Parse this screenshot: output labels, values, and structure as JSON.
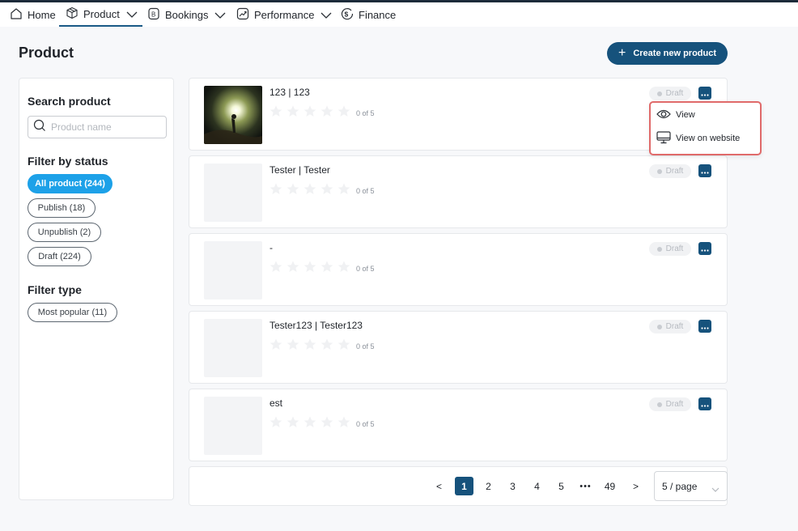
{
  "nav": {
    "items": [
      {
        "label": "Home",
        "icon": "home-icon"
      },
      {
        "label": "Product",
        "icon": "box-icon",
        "has_dropdown": true,
        "active": true
      },
      {
        "label": "Bookings",
        "icon": "bookings-icon",
        "has_dropdown": true
      },
      {
        "label": "Performance",
        "icon": "trend-icon",
        "has_dropdown": true
      },
      {
        "label": "Finance",
        "icon": "dollar-icon"
      }
    ]
  },
  "page": {
    "title": "Product",
    "create_button": "Create new product"
  },
  "sidebar": {
    "search_heading": "Search product",
    "search_placeholder": "Product name",
    "status_heading": "Filter by status",
    "status_filters": [
      "All product (244)",
      "Publish (18)",
      "Unpublish (2)",
      "Draft (224)"
    ],
    "active_status_filter": "All product (244)",
    "type_heading": "Filter type",
    "type_filters": [
      "Most popular (11)"
    ]
  },
  "products": [
    {
      "title": "123 | 123",
      "rating_text": "0 of 5",
      "rating": 0,
      "status": "Draft",
      "has_image": true
    },
    {
      "title": "Tester | Tester",
      "rating_text": "0 of 5",
      "rating": 0,
      "status": "Draft",
      "has_image": false
    },
    {
      "title": "-",
      "rating_text": "0 of 5",
      "rating": 0,
      "status": "Draft",
      "has_image": false
    },
    {
      "title": "Tester123 | Tester123",
      "rating_text": "0 of 5",
      "rating": 0,
      "status": "Draft",
      "has_image": false
    },
    {
      "title": "est",
      "rating_text": "0 of 5",
      "rating": 0,
      "status": "Draft",
      "has_image": false
    }
  ],
  "menu": {
    "items": [
      {
        "label": "View",
        "icon": "eye-icon"
      },
      {
        "label": "View on website",
        "icon": "monitor-icon"
      }
    ]
  },
  "pagination": {
    "prev": "<",
    "next": ">",
    "pages": [
      "1",
      "2",
      "3",
      "4",
      "5"
    ],
    "ellipsis": "•••",
    "last": "49",
    "current": "1",
    "page_size": "5 / page"
  },
  "colors": {
    "primary": "#16527c",
    "active_filter": "#1da1e8",
    "menu_highlight": "#e06a6a"
  }
}
